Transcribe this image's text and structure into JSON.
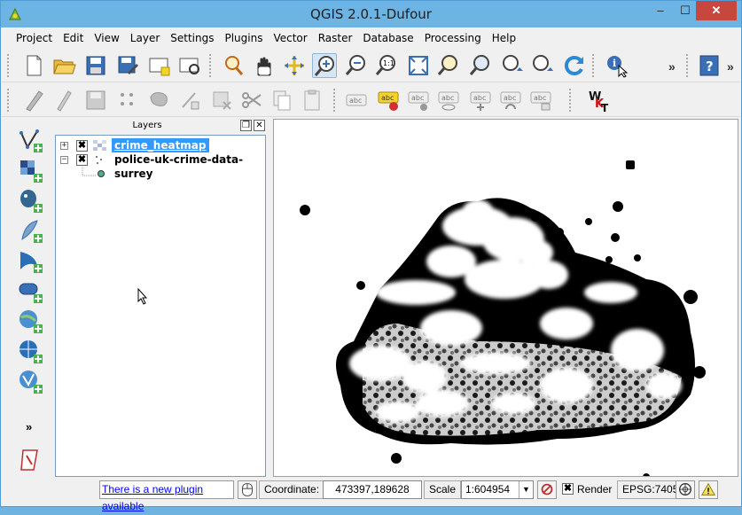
{
  "window": {
    "title": "QGIS 2.0.1-Dufour",
    "minimize_glyph": "‒",
    "maximize_glyph": "☐",
    "close_glyph": "✕"
  },
  "menu": [
    "Project",
    "Edit",
    "View",
    "Layer",
    "Settings",
    "Plugins",
    "Vector",
    "Raster",
    "Database",
    "Processing",
    "Help"
  ],
  "toolbar1": {
    "icons": [
      "new-project-icon",
      "open-project-icon",
      "save-project-icon",
      "save-as-icon",
      "new-print-composer-icon",
      "composer-manager-icon",
      "pan-to-selection-icon",
      "pan-map-icon",
      "touch-zoom-icon",
      "zoom-in-icon",
      "zoom-out-icon",
      "zoom-actual-size-icon",
      "zoom-full-icon",
      "zoom-to-selection-icon",
      "zoom-to-layer-icon",
      "zoom-last-icon",
      "zoom-next-icon",
      "refresh-icon",
      "identify-features-icon",
      "help-icon"
    ],
    "more_glyph": "»"
  },
  "toolbar2": {
    "icons": [
      "current-edits-icon",
      "toggle-editing-icon",
      "save-layer-edits-icon",
      "add-feature-icon",
      "move-feature-icon",
      "node-tool-icon",
      "delete-selected-icon",
      "cut-features-icon",
      "copy-features-icon",
      "paste-features-icon",
      "label-icon",
      "layer-labeling-icon",
      "pin-labels-icon",
      "show-hide-labels-icon",
      "move-label-icon",
      "rotate-label-icon",
      "change-label-icon",
      "wkt-icon"
    ],
    "label_text": "abc",
    "wkt_text": "W",
    "wkt_sub": "K",
    "wkt_t": "T"
  },
  "left_toolbar": {
    "icons": [
      "add-vector-layer-icon",
      "add-raster-layer-icon",
      "add-postgis-layer-icon",
      "add-spatialite-layer-icon",
      "add-mssql-layer-icon",
      "add-oracle-layer-icon",
      "add-wms-layer-icon",
      "add-wcs-layer-icon",
      "add-wfs-layer-icon",
      "georeferencer-icon"
    ],
    "more_glyph": "»"
  },
  "layers_panel": {
    "title": "Layers",
    "float_glyph": "❐",
    "close_glyph": "✕",
    "layers": [
      {
        "name": "crime_heatmap",
        "checked_glyph": "✖",
        "expander": "+",
        "selected": true
      },
      {
        "name": "police-uk-crime-data-surrey",
        "checked_glyph": "✖",
        "expander": "−",
        "selected": false
      }
    ]
  },
  "statusbar": {
    "plugin_notice": "There is a new plugin available",
    "coordinate_label": "Coordinate:",
    "coordinate_value": "473397,189628",
    "scale_label": "Scale",
    "scale_value": "1:604954",
    "dropdown_glyph": "▼",
    "render_checked_glyph": "✖",
    "render_label": "Render",
    "crs": "EPSG:7405"
  }
}
